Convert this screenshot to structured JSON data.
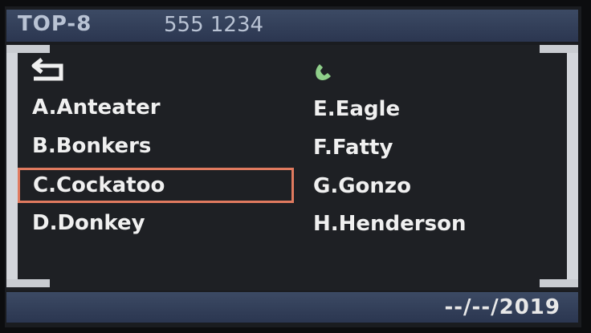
{
  "header": {
    "title": "TOP-8",
    "number": "555 1234"
  },
  "contacts_left": [
    {
      "label": "A.Anteater"
    },
    {
      "label": "B.Bonkers"
    },
    {
      "label": "C.Cockatoo",
      "selected": true
    },
    {
      "label": "D.Donkey"
    }
  ],
  "contacts_right": [
    {
      "label": "E.Eagle"
    },
    {
      "label": "F.Fatty"
    },
    {
      "label": "G.Gonzo"
    },
    {
      "label": "H.Henderson"
    }
  ],
  "footer": {
    "date": "--/--/2019"
  },
  "icons": {
    "back": "back-arrow-icon",
    "call": "phone-icon"
  },
  "colors": {
    "selection": "#e07a5f",
    "call_icon": "#8fcf8a",
    "header_bg": "#33405a"
  }
}
